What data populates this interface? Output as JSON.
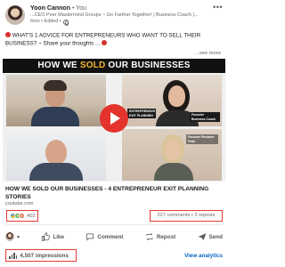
{
  "author": {
    "name": "Yoon Cannon",
    "degree": "• You",
    "headline": "...CEO Peer Mastermind Groups ~ Go Farther Together! | Business Coach |...",
    "time": "6mo • Edited •"
  },
  "post": {
    "text": "WHAT'S 1 ADVICE FOR ENTREPRENEURS WHO WANT TO SELL THEIR BUSINESS? ~ Share your thoughts ...",
    "see_more": "...see more"
  },
  "video": {
    "title_part1": "HOW WE ",
    "title_highlight": "SOLD",
    "title_part2": " OUR BUSINESSES",
    "banner1": "ENTREPRENEUR EXIT PLANNING",
    "banner2": "Founder Business Coach",
    "banner3": "Founder Pinnacle Peak"
  },
  "link": {
    "title": "HOW WE SOLD OUR BUSINESSES - 4 ENTREPRENEUR EXIT PLANNING STORIES",
    "domain": "youtube.com"
  },
  "stats": {
    "reactions": "402",
    "comments_reposts": "227 comments • 2 reposts"
  },
  "actions": {
    "like": "Like",
    "comment": "Comment",
    "repost": "Repost",
    "send": "Send"
  },
  "impressions": {
    "label": "4,507 impressions",
    "analytics": "View analytics"
  },
  "colors": {
    "highlight_box": "#e53935",
    "play_button": "#e4332d",
    "link_blue": "#0a66c2",
    "title_gold": "#f2b632"
  }
}
